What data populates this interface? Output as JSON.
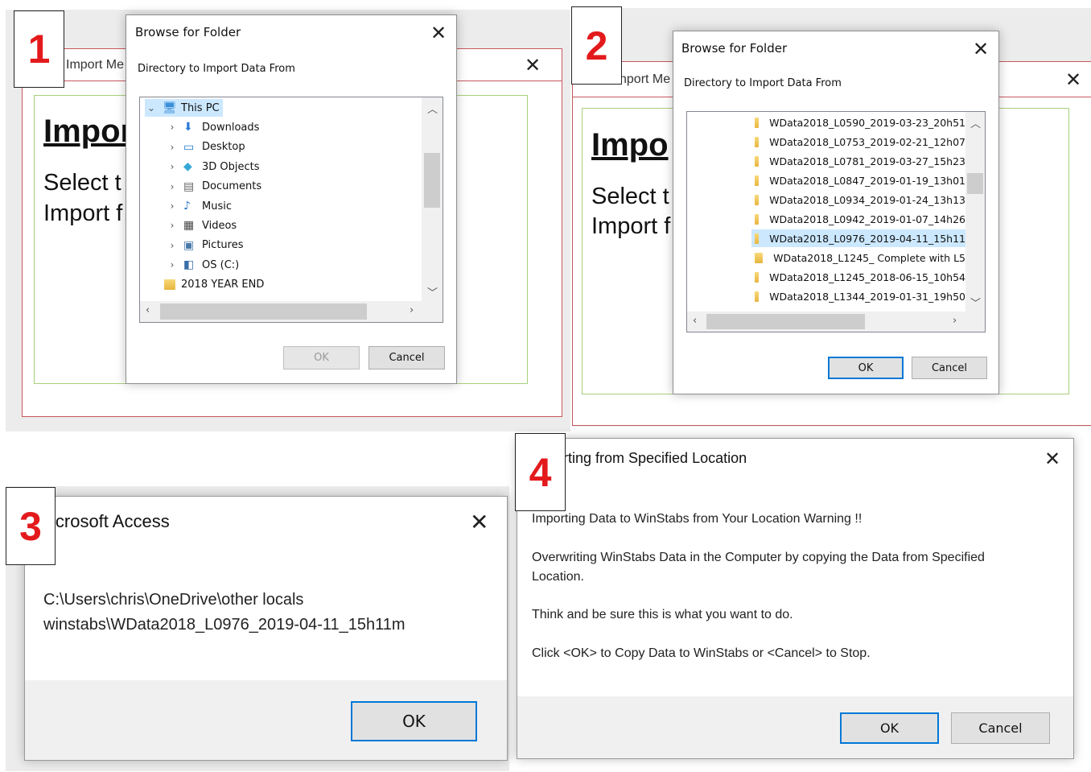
{
  "panel1": {
    "badge": "1",
    "bg_window_title": "Import Me",
    "bg_heading": "Impor",
    "bg_text_line1": "Select t",
    "bg_text_line2": "Import f",
    "dialog_title": "Browse for Folder",
    "instruction": "Directory to Import Data From",
    "tree_items": [
      {
        "label": "This PC",
        "icon": "pc-icon",
        "expanded": true,
        "selected": true
      },
      {
        "label": "Downloads",
        "icon": "download-icon"
      },
      {
        "label": "Desktop",
        "icon": "desktop-icon"
      },
      {
        "label": "3D Objects",
        "icon": "cube-icon"
      },
      {
        "label": "Documents",
        "icon": "document-icon"
      },
      {
        "label": "Music",
        "icon": "music-icon"
      },
      {
        "label": "Videos",
        "icon": "video-icon"
      },
      {
        "label": "Pictures",
        "icon": "picture-icon"
      },
      {
        "label": "OS (C:)",
        "icon": "drive-icon"
      },
      {
        "label": "2018 YEAR END",
        "icon": "folder-icon"
      }
    ],
    "ok_label": "OK",
    "ok_enabled": false,
    "cancel_label": "Cancel"
  },
  "panel2": {
    "badge": "2",
    "bg_window_title": "nport Me",
    "bg_heading": "Impo",
    "bg_text_line1": "Select t",
    "bg_text_line2": "Import f",
    "dialog_title": "Browse for Folder",
    "instruction": "Directory to Import Data From",
    "folders": [
      "WData2018_L0590_2019-03-23_20h51",
      "WData2018_L0753_2019-02-21_12h07",
      "WData2018_L0781_2019-03-27_15h23",
      "WData2018_L0847_2019-01-19_13h01",
      "WData2018_L0934_2019-01-24_13h13",
      "WData2018_L0942_2019-01-07_14h26",
      "WData2018_L0976_2019-04-11_15h11",
      "WData2018_L1245_ Complete with L5",
      "WData2018_L1245_2018-06-15_10h54",
      "WData2018_L1344_2019-01-31_19h50"
    ],
    "selected_index": 6,
    "ok_label": "OK",
    "cancel_label": "Cancel"
  },
  "panel3": {
    "badge": "3",
    "dialog_title": "icrosoft Access",
    "message_line1": "C:\\Users\\chris\\OneDrive\\other locals",
    "message_line2": "winstabs\\WData2018_L0976_2019-04-11_15h11m",
    "ok_label": "OK"
  },
  "panel4": {
    "badge": "4",
    "dialog_title": "rting from Specified Location",
    "line1": "Importing Data to WinStabs from Your Location Warning !!",
    "line2a": "Overwriting WinStabs Data in the Computer by copying the Data from Specified",
    "line2b": "Location.",
    "line3": "Think and be sure this is what you want to do.",
    "line4": "Click <OK> to Copy Data to WinStabs or <Cancel> to Stop.",
    "ok_label": "OK",
    "cancel_label": "Cancel"
  },
  "colors": {
    "badge_number": "#e31a1c",
    "accent_border": "#0078d7",
    "bg_window_border": "#c9585e",
    "bg_inner_border": "#a9cf7a"
  }
}
